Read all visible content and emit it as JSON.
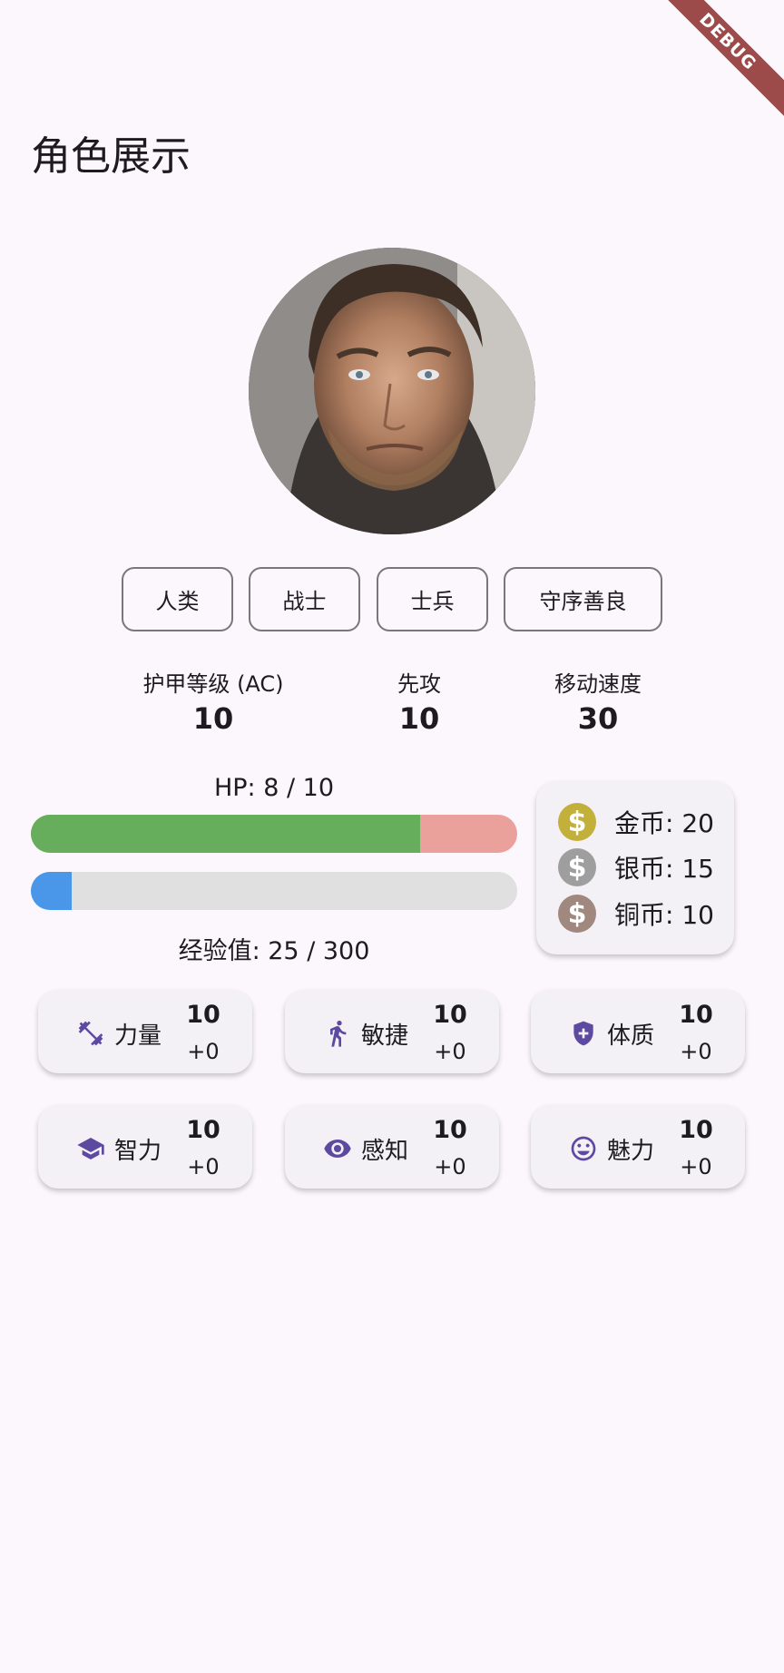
{
  "debug_banner": "DEBUG",
  "page_title": "角色展示",
  "tags": [
    "人类",
    "战士",
    "士兵",
    "守序善良"
  ],
  "stats": [
    {
      "label": "护甲等级 (AC)",
      "value": "10"
    },
    {
      "label": "先攻",
      "value": "10"
    },
    {
      "label": "移动速度",
      "value": "30"
    }
  ],
  "hp": {
    "label": "HP: 8 / 10",
    "current": 8,
    "max": 10,
    "fill_color": "#66ad5c",
    "empty_color": "#eba19b"
  },
  "xp": {
    "label": "经验值: 25 / 300",
    "current": 25,
    "max": 300,
    "fill_color": "#4a97ea",
    "empty_color": "#e0e0e0"
  },
  "coins": [
    {
      "label": "金币: 20",
      "icon": "dollar-coin-icon",
      "color": "#c2b03a"
    },
    {
      "label": "银币: 15",
      "icon": "dollar-coin-icon",
      "color": "#9e9e9e"
    },
    {
      "label": "铜币: 10",
      "icon": "dollar-coin-icon",
      "color": "#a1887f"
    }
  ],
  "attributes": [
    {
      "name": "力量",
      "score": "10",
      "modifier": "+0",
      "icon": "fitness-dumbbell-icon"
    },
    {
      "name": "敏捷",
      "score": "10",
      "modifier": "+0",
      "icon": "running-figure-icon"
    },
    {
      "name": "体质",
      "score": "10",
      "modifier": "+0",
      "icon": "health-shield-icon"
    },
    {
      "name": "智力",
      "score": "10",
      "modifier": "+0",
      "icon": "graduation-cap-icon"
    },
    {
      "name": "感知",
      "score": "10",
      "modifier": "+0",
      "icon": "eye-icon"
    },
    {
      "name": "魅力",
      "score": "10",
      "modifier": "+0",
      "icon": "smiley-face-icon"
    }
  ],
  "accent_color": "#5c4aa0"
}
